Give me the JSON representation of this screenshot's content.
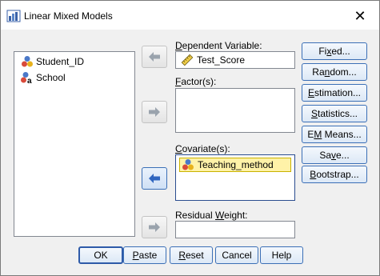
{
  "window": {
    "title": "Linear Mixed Models",
    "close_symbol": "✕"
  },
  "source_variables": [
    {
      "label": "Student_ID",
      "icon": "nominal-variable-icon"
    },
    {
      "label": "School",
      "icon": "nominal-string-variable-icon"
    }
  ],
  "dependent": {
    "label_pre": "",
    "label_mn": "D",
    "label_post": "ependent Variable:",
    "value": "Test_Score",
    "icon": "scale-variable-icon"
  },
  "factors": {
    "label_pre": "",
    "label_mn": "F",
    "label_post": "actor(s):"
  },
  "covariates": {
    "label_pre": "",
    "label_mn": "C",
    "label_post": "ovariate(s):",
    "items": [
      {
        "label": "Teaching_method",
        "icon": "nominal-variable-icon"
      }
    ]
  },
  "residual_weight": {
    "label_pre": "Residual ",
    "label_mn": "W",
    "label_post": "eight:",
    "value": ""
  },
  "side_buttons": {
    "fixed": {
      "pre": "Fi",
      "mn": "x",
      "post": "ed..."
    },
    "random": {
      "pre": "Ra",
      "mn": "n",
      "post": "dom..."
    },
    "estimation": {
      "pre": "",
      "mn": "E",
      "post": "stimation..."
    },
    "statistics": {
      "pre": "",
      "mn": "S",
      "post": "tatistics..."
    },
    "em_means": {
      "pre": "E",
      "mn": "M",
      "post": " Means..."
    },
    "save": {
      "pre": "Sa",
      "mn": "v",
      "post": "e..."
    },
    "bootstrap": {
      "pre": "",
      "mn": "B",
      "post": "ootstrap..."
    }
  },
  "bottom_buttons": {
    "ok": {
      "pre": "OK",
      "mn": "",
      "post": ""
    },
    "paste": {
      "pre": "",
      "mn": "P",
      "post": "aste"
    },
    "reset": {
      "pre": "",
      "mn": "R",
      "post": "eset"
    },
    "cancel": {
      "pre": "Cancel",
      "mn": "",
      "post": ""
    },
    "help": {
      "pre": "Help",
      "mn": "",
      "post": ""
    }
  },
  "colors": {
    "accent": "#3b6fb6",
    "selection": "#fff2a8",
    "window_bg": "#f0f0f0"
  }
}
